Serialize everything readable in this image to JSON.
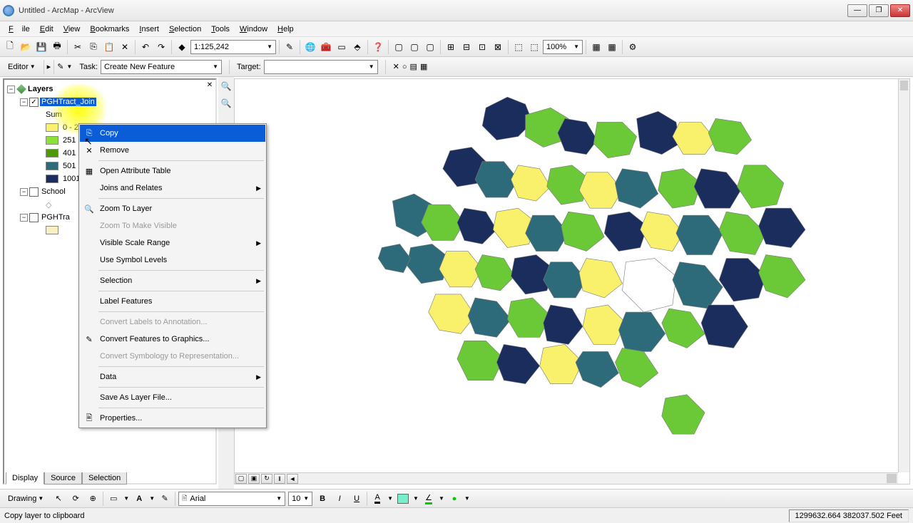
{
  "window": {
    "title": "Untitled - ArcMap - ArcView"
  },
  "menu": {
    "file": "File",
    "edit": "Edit",
    "view": "View",
    "bookmarks": "Bookmarks",
    "insert": "Insert",
    "selection": "Selection",
    "tools": "Tools",
    "window": "Window",
    "help": "Help"
  },
  "toolbar": {
    "scale": "1:125,242",
    "zoom_pct": "100%"
  },
  "editor": {
    "label": "Editor",
    "task_label": "Task:",
    "task_value": "Create New Feature",
    "target_label": "Target:",
    "target_value": ""
  },
  "toc": {
    "root": "Layers",
    "layer1": {
      "name": "PGHTract_Join",
      "field": "Sum",
      "classes": [
        {
          "label": "0 - 2",
          "color": "#f9f06b"
        },
        {
          "label": "251",
          "color": "#8ae234"
        },
        {
          "label": "401",
          "color": "#4e9a06"
        },
        {
          "label": "501",
          "color": "#2e6b7a"
        },
        {
          "label": "1001",
          "color": "#1a2d5c"
        }
      ]
    },
    "layer2": {
      "name": "School"
    },
    "layer3": {
      "name": "PGHTra"
    },
    "tabs": {
      "display": "Display",
      "source": "Source",
      "selection": "Selection"
    }
  },
  "context": {
    "copy": "Copy",
    "remove": "Remove",
    "open_table": "Open Attribute Table",
    "joins": "Joins and Relates",
    "zoom_layer": "Zoom To Layer",
    "zoom_visible": "Zoom To Make Visible",
    "scale_range": "Visible Scale Range",
    "symbol_levels": "Use Symbol Levels",
    "selection": "Selection",
    "label_features": "Label Features",
    "convert_labels": "Convert Labels to Annotation...",
    "convert_features": "Convert Features to Graphics...",
    "convert_symbology": "Convert Symbology to Representation...",
    "data": "Data",
    "save_layer": "Save As Layer File...",
    "properties": "Properties..."
  },
  "drawing": {
    "label": "Drawing",
    "font": "Arial",
    "size": "10"
  },
  "status": {
    "text": "Copy layer to clipboard",
    "coords": "1299632.664 382037.502 Feet"
  }
}
